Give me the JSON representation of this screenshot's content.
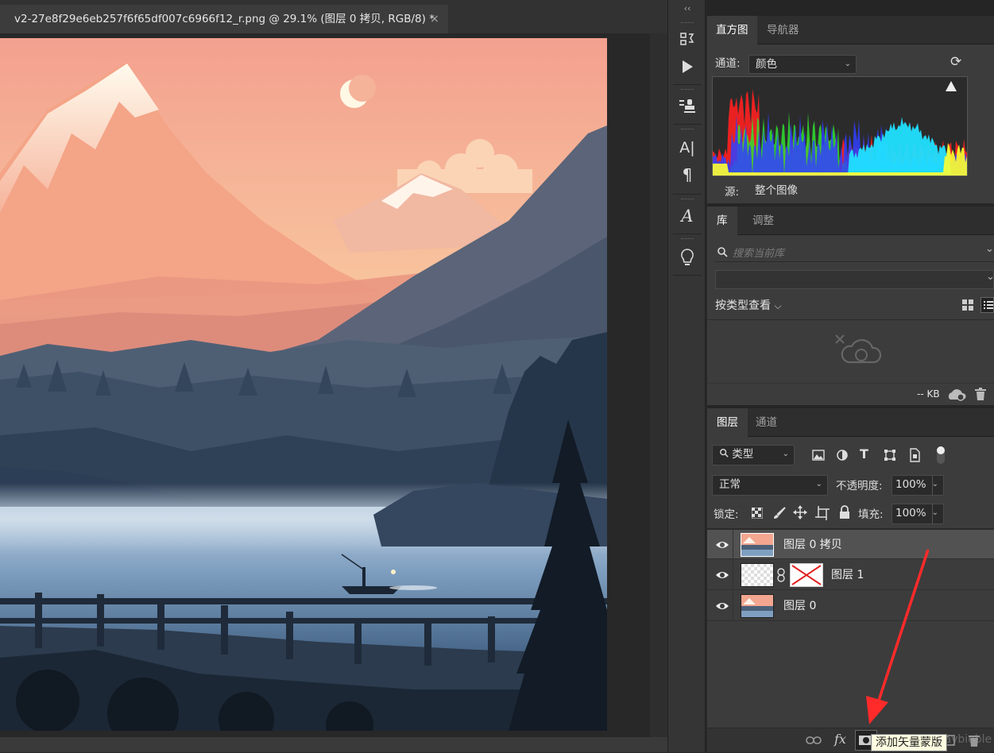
{
  "document": {
    "tab_title": "v2-27e8f29e6eb257f6f65df007c6966f12_r.png @ 29.1% (图层 0 拷贝, RGB/8) *",
    "close_glyph": "×"
  },
  "toolbar": {
    "collapse_glyph": "‹‹",
    "char_label": "A|",
    "para_label": "¶",
    "glyph_label": "A"
  },
  "histogram": {
    "tabs": [
      "直方图",
      "导航器"
    ],
    "channel_label": "通道:",
    "channel_value": "颜色",
    "source_label": "源:",
    "source_value": "整个图像"
  },
  "library": {
    "tabs": [
      "库",
      "调整"
    ],
    "search_placeholder": "搜索当前库",
    "view_by": "按类型查看",
    "size": "-- KB"
  },
  "layers": {
    "tabs": [
      "图层",
      "通道"
    ],
    "filter_value": "类型",
    "blend_mode": "正常",
    "opacity_label": "不透明度:",
    "opacity_value": "100%",
    "lock_label": "锁定:",
    "fill_label": "填充:",
    "fill_value": "100%",
    "items": [
      {
        "name": "图层 0 拷贝",
        "selected": true
      },
      {
        "name": "图层 1",
        "selected": false
      },
      {
        "name": "图层 0",
        "selected": false
      }
    ],
    "fx_label": "fx",
    "tooltip": "添加矢量蒙版",
    "watermark": "CSDN @Jaybieble"
  },
  "colors": {
    "accent_arrow": "#ff2a2a",
    "panel_bg": "#3c3c3c",
    "selected_layer": "#525252"
  }
}
